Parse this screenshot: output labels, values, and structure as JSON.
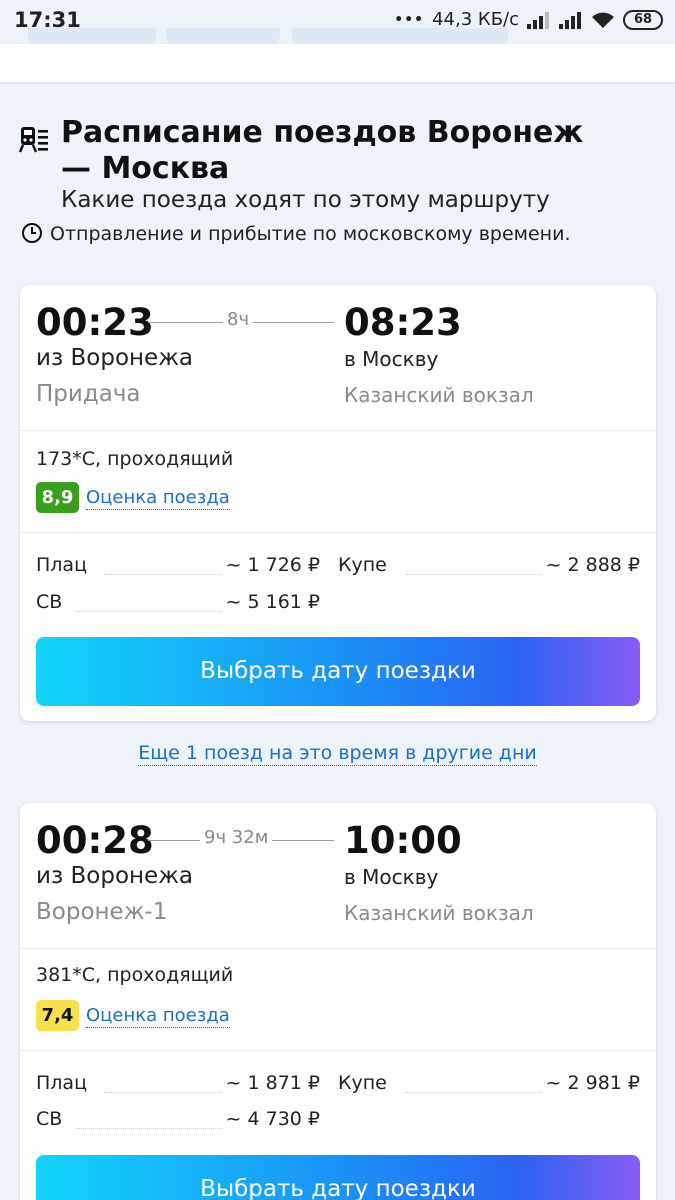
{
  "status_bar": {
    "time": "17:31",
    "dots": "•••",
    "speed": "44,3 КБ/с",
    "battery": "68"
  },
  "header": {
    "title": "Расписание поездов Воронеж — Москва",
    "subtitle": "Какие поезда ходят по этому маршруту",
    "note": "Отправление и прибытие по московскому времени."
  },
  "trains": [
    {
      "depart_time": "00:23",
      "arrive_time": "08:23",
      "duration": "8ч",
      "from_city": "из Воронежа",
      "to_city": "в Москву",
      "from_station": "Придача",
      "to_station": "Казанский вокзал",
      "train_info": "173*С, проходящий",
      "rating": "8,9",
      "rating_color": "#3a9f1c",
      "rating_link": "Оценка поезда",
      "prices": [
        {
          "label": "Плац",
          "value": "~ 1 726 ₽"
        },
        {
          "label": "Купе",
          "value": "~ 2 888 ₽"
        },
        {
          "label": "СВ",
          "value": "~ 5 161 ₽"
        }
      ],
      "button": "Выбрать дату поездки"
    },
    {
      "depart_time": "00:28",
      "arrive_time": "10:00",
      "duration": "9ч 32м",
      "from_city": "из Воронежа",
      "to_city": "в Москву",
      "from_station": "Воронеж-1",
      "to_station": "Казанский вокзал",
      "train_info": "381*С, проходящий",
      "rating": "7,4",
      "rating_color": "#f8e04c",
      "rating_link": "Оценка поезда",
      "prices": [
        {
          "label": "Плац",
          "value": "~ 1 871 ₽"
        },
        {
          "label": "Купе",
          "value": "~ 2 981 ₽"
        },
        {
          "label": "СВ",
          "value": "~ 4 730 ₽"
        }
      ],
      "button": "Выбрать дату поездки"
    }
  ],
  "more_link": "Еще 1 поезд на это время в другие дни"
}
